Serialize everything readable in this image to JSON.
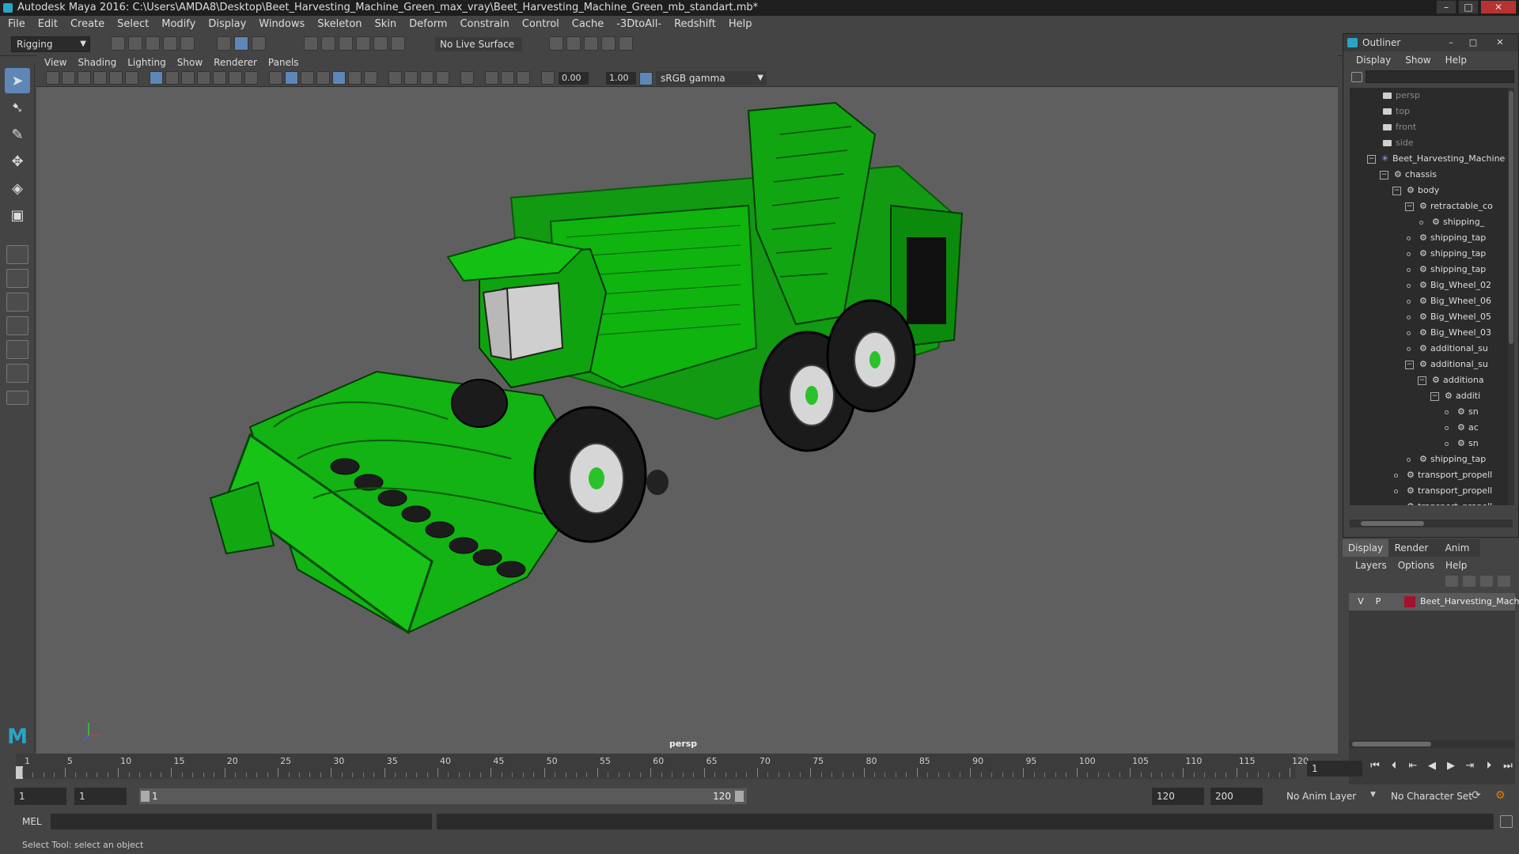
{
  "window": {
    "title": "Autodesk Maya 2016: C:\\Users\\AMDA8\\Desktop\\Beet_Harvesting_Machine_Green_max_vray\\Beet_Harvesting_Machine_Green_mb_standart.mb*",
    "minimize": "–",
    "maximize": "□",
    "close": "✕"
  },
  "menubar": [
    "File",
    "Edit",
    "Create",
    "Select",
    "Modify",
    "Display",
    "Windows",
    "Skeleton",
    "Skin",
    "Deform",
    "Constrain",
    "Control",
    "Cache",
    "-3DtoAll-",
    "Redshift",
    "Help"
  ],
  "toolbar": {
    "mode": "Rigging",
    "live_surface": "No Live Surface"
  },
  "viewport": {
    "menu": [
      "View",
      "Shading",
      "Lighting",
      "Show",
      "Renderer",
      "Panels"
    ],
    "field_a": "0.00",
    "field_b": "1.00",
    "gamma": "sRGB gamma",
    "camera_label": "persp"
  },
  "outliner": {
    "title": "Outliner",
    "menu": [
      "Display",
      "Show",
      "Help"
    ],
    "rows": [
      {
        "label": "persp"
      },
      {
        "label": "top"
      },
      {
        "label": "front"
      },
      {
        "label": "side"
      },
      {
        "label": "Beet_Harvesting_Machine"
      },
      {
        "label": "chassis"
      },
      {
        "label": "body"
      },
      {
        "label": "retractable_co"
      },
      {
        "label": "shipping_"
      },
      {
        "label": "shipping_tap"
      },
      {
        "label": "shipping_tap"
      },
      {
        "label": "shipping_tap"
      },
      {
        "label": "Big_Wheel_02"
      },
      {
        "label": "Big_Wheel_06"
      },
      {
        "label": "Big_Wheel_05"
      },
      {
        "label": "Big_Wheel_03"
      },
      {
        "label": "additional_su"
      },
      {
        "label": "additional_su"
      },
      {
        "label": "additiona"
      },
      {
        "label": "additi"
      },
      {
        "label": "sn"
      },
      {
        "label": "ac"
      },
      {
        "label": "sn"
      },
      {
        "label": "shipping_tap"
      },
      {
        "label": "transport_propell"
      },
      {
        "label": "transport_propell"
      },
      {
        "label": "transport_propell"
      }
    ]
  },
  "layers": {
    "tabs": [
      "Display",
      "Render",
      "Anim"
    ],
    "menu": [
      "Layers",
      "Options",
      "Help"
    ],
    "layer": {
      "v": "V",
      "p": "P",
      "name": "Beet_Harvesting_Mach",
      "color": "#a3122c"
    }
  },
  "timeline": {
    "ticks": [
      "1",
      "5",
      "10",
      "15",
      "20",
      "25",
      "30",
      "35",
      "40",
      "45",
      "50",
      "55",
      "60",
      "65",
      "70",
      "75",
      "80",
      "85",
      "90",
      "95",
      "100",
      "105",
      "110",
      "115",
      "120"
    ],
    "current_frame": "1"
  },
  "range": {
    "start": "1",
    "start2": "1",
    "slider_start": "1",
    "slider_end": "120",
    "end": "120",
    "end2": "200",
    "anim_layer": "No Anim Layer",
    "char_set": "No Character Set"
  },
  "command": {
    "lang": "MEL"
  },
  "status": {
    "text": "Select Tool: select an object"
  }
}
